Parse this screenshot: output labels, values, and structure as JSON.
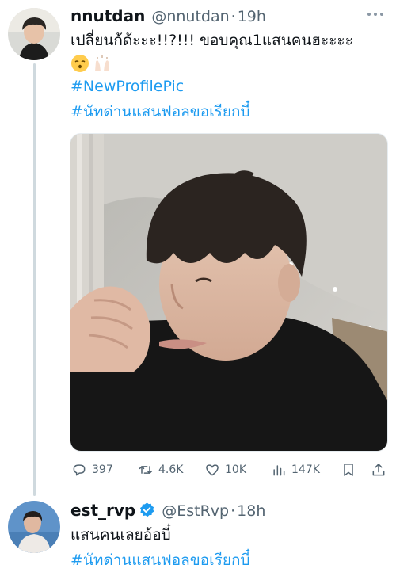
{
  "tweets": [
    {
      "display_name": "nnutdan",
      "handle": "@nnutdan",
      "separator": "·",
      "time": "19h",
      "text": "เปลี่ยนก้ด้ะะะ!!?!!! ขอบคุณ1แสนคนฮะะะะ",
      "emojis": [
        "kissing-face-emoji",
        "raising-hands-emoji"
      ],
      "hashtags": [
        "#NewProfilePic",
        "#นัทด่านแสนฟอลขอเรียกบี๋"
      ],
      "stats": {
        "replies": "397",
        "retweets": "4.6K",
        "likes": "10K",
        "views": "147K"
      }
    },
    {
      "display_name": "est_rvp",
      "verified": true,
      "handle": "@EstRvp",
      "separator": "·",
      "time": "18h",
      "text": "แสนคนเลยอ้อบี๋",
      "hashtags": [
        "#นัทด่านแสนฟอลขอเรียกบี๋"
      ]
    }
  ],
  "colors": {
    "link": "#1d9bf0",
    "secondary_text": "#536471",
    "thread_line": "#cfd9de"
  }
}
